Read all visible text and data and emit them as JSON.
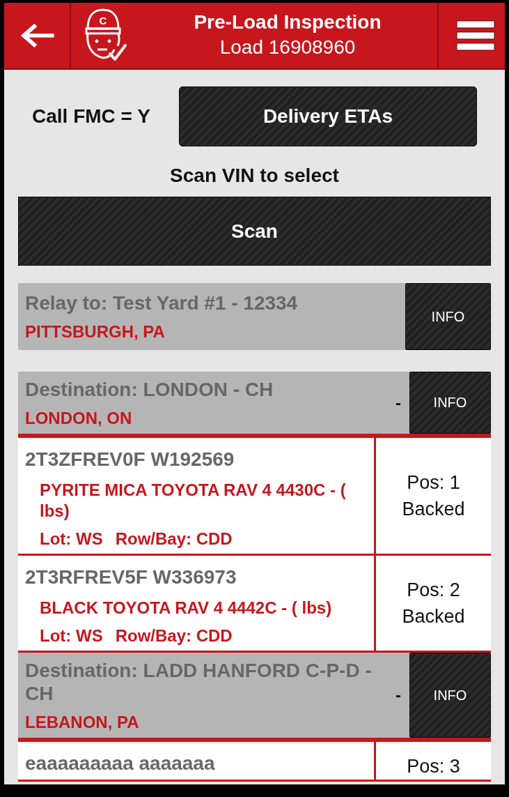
{
  "header": {
    "title": "Pre-Load Inspection",
    "subtitle": "Load 16908960",
    "logo_letter": "C"
  },
  "call_fmc": "Call FMC = Y",
  "delivery_button": "Delivery ETAs",
  "scan_hint": "Scan VIN to select",
  "scan_button": "Scan",
  "groups": [
    {
      "kind": "relay",
      "title": "Relay to: Test Yard #1 - 12334",
      "location": "PITTSBURGH, PA",
      "info_button": "INFO"
    },
    {
      "kind": "destination",
      "title": "Destination: LONDON - CH",
      "location": "LONDON, ON",
      "marker": "-",
      "info_button": "INFO",
      "vehicles": [
        {
          "vin": "2T3ZFREV0F W192569",
          "description": "PYRITE MICA TOYOTA RAV 4 4430C - ( lbs)",
          "lot": "Lot: WS",
          "row_bay": "Row/Bay: CDD",
          "position": "Pos: 1",
          "status": "Backed"
        },
        {
          "vin": "2T3RFREV5F W336973",
          "description": "BLACK TOYOTA RAV 4 4442C - ( lbs)",
          "lot": "Lot: WS",
          "row_bay": "Row/Bay: CDD",
          "position": "Pos: 2",
          "status": "Backed"
        }
      ]
    },
    {
      "kind": "destination",
      "title": "Destination: LADD HANFORD C-P-D - CH",
      "location": "LEBANON, PA",
      "marker": "-",
      "info_button": "INFO",
      "vehicles": [
        {
          "vin": "eaaaaaaaaa aaaaaaa",
          "position": "Pos: 3"
        }
      ]
    }
  ]
}
